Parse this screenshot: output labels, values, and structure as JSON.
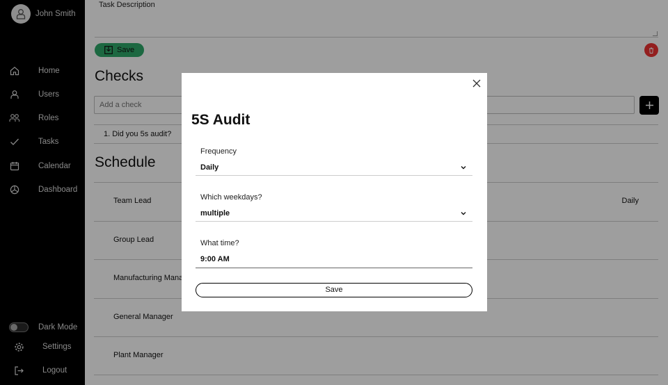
{
  "user": {
    "name": "John Smith"
  },
  "nav": [
    {
      "label": "Home",
      "icon": "home-icon"
    },
    {
      "label": "Users",
      "icon": "user-icon"
    },
    {
      "label": "Roles",
      "icon": "roles-icon"
    },
    {
      "label": "Tasks",
      "icon": "check-icon"
    },
    {
      "label": "Calendar",
      "icon": "calendar-icon"
    },
    {
      "label": "Dashboard",
      "icon": "dashboard-icon"
    }
  ],
  "footer": {
    "dark_mode": "Dark Mode",
    "settings": "Settings",
    "logout": "Logout"
  },
  "task": {
    "description_label": "Task Description",
    "save_label": "Save"
  },
  "checks": {
    "title": "Checks",
    "add_placeholder": "Add a check",
    "items": [
      "1. Did you 5s audit?"
    ]
  },
  "schedule": {
    "title": "Schedule",
    "rows": [
      {
        "role": "Team Lead",
        "frequency": "Daily"
      },
      {
        "role": "Group Lead",
        "frequency": ""
      },
      {
        "role": "Manufacturing Mana",
        "frequency": ""
      },
      {
        "role": "General Manager",
        "frequency": ""
      },
      {
        "role": "Plant Manager",
        "frequency": ""
      }
    ]
  },
  "modal": {
    "title": "5S Audit",
    "frequency_label": "Frequency",
    "frequency_value": "Daily",
    "weekdays_label": "Which weekdays?",
    "weekdays_value": "multiple",
    "time_label": "What time?",
    "time_value": "9:00 AM",
    "save_label": "Save"
  },
  "colors": {
    "save_green": "#2ea86a",
    "delete_red": "#e33333",
    "sidebar_bg": "#000000"
  }
}
